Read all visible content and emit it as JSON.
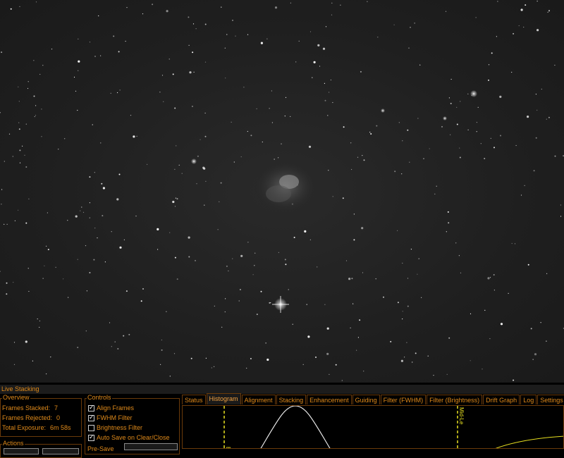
{
  "panel": {
    "title": "Live Stacking"
  },
  "overview": {
    "label": "Overview",
    "rows": [
      {
        "label": "Frames Stacked:",
        "value": "7"
      },
      {
        "label": "Frames Rejected:",
        "value": "0"
      },
      {
        "label": "Total Exposure:",
        "value": "6m 58s"
      }
    ]
  },
  "actions": {
    "label": "Actions"
  },
  "controls": {
    "label": "Controls",
    "items": [
      {
        "label": "Align Frames",
        "checked": true
      },
      {
        "label": "FWHM Filter",
        "checked": true
      },
      {
        "label": "Brightness Filter",
        "checked": false
      },
      {
        "label": "Auto Save on Clear/Close",
        "checked": true
      }
    ],
    "partial_label": "Pre-Save"
  },
  "tabs": [
    "Status",
    "Histogram",
    "Alignment",
    "Stacking",
    "Enhancement",
    "Guiding",
    "Filter (FWHM)",
    "Filter (Brightness)",
    "Drift Graph",
    "Log",
    "Settings"
  ],
  "active_tab": "Histogram",
  "histogram": {
    "marker_left_label": "Bl",
    "marker_mid_label": "Mid-Le",
    "marker_color": "#e8e020",
    "curve_color": "#e8e8e8",
    "curve2_color": "#e8e020"
  },
  "colors": {
    "accent": "#e08a1a",
    "border": "#6a3a0a",
    "background": "#000000",
    "sky": "#222222"
  }
}
